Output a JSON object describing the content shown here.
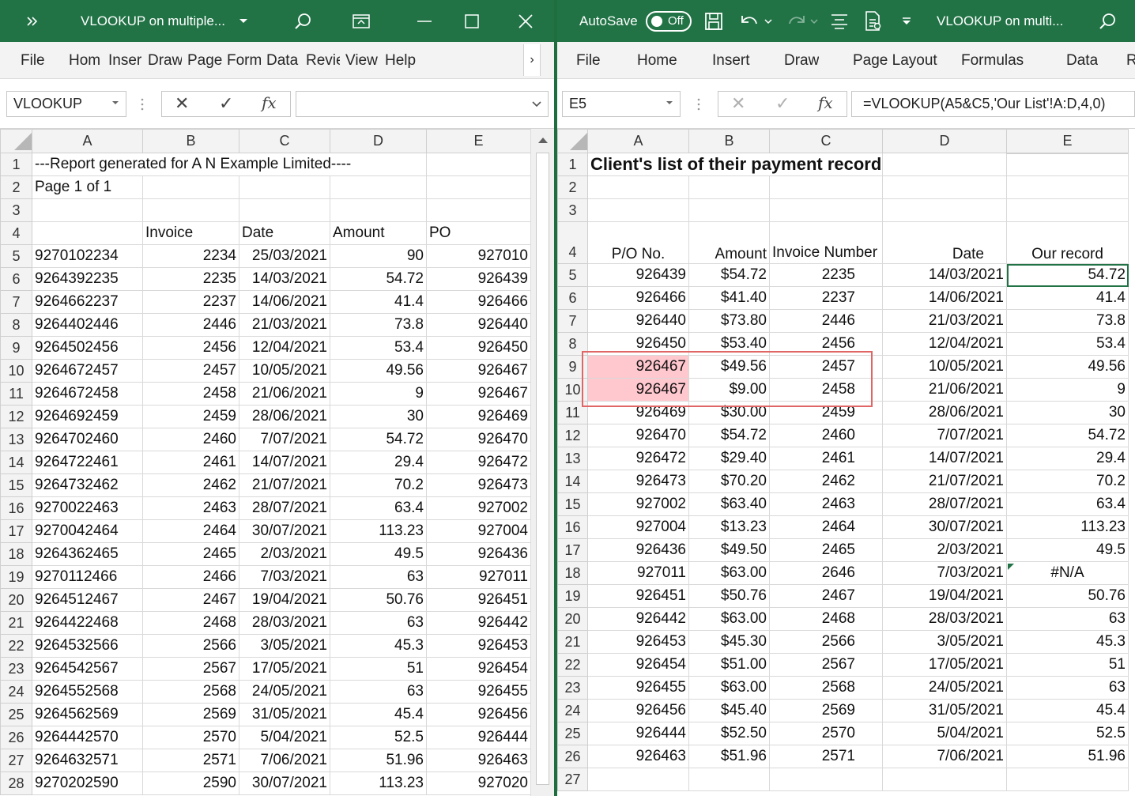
{
  "left": {
    "title": "VLOOKUP on multiple...",
    "ribbon_tabs": [
      "File",
      "Hom",
      "Inser",
      "Draw",
      "Page",
      "Form",
      "Data",
      "Revie",
      "View",
      "Help"
    ],
    "ribbon_more": "›",
    "name_box": "VLOOKUP",
    "formula": "",
    "columns": [
      "A",
      "B",
      "C",
      "D",
      "E"
    ],
    "rows": [
      {
        "n": "1",
        "a": "---Report generated for A N Example Limited----",
        "b": "",
        "c": "",
        "d": "",
        "e": ""
      },
      {
        "n": "2",
        "a": "Page 1 of 1",
        "b": "",
        "c": "",
        "d": "",
        "e": ""
      },
      {
        "n": "3",
        "a": "",
        "b": "",
        "c": "",
        "d": "",
        "e": ""
      },
      {
        "n": "4",
        "a": "",
        "b": "Invoice",
        "c": "Date",
        "d": "Amount",
        "e": "PO"
      },
      {
        "n": "5",
        "a": "9270102234",
        "b": "2234",
        "c": "25/03/2021",
        "d": "90",
        "e": "927010"
      },
      {
        "n": "6",
        "a": "9264392235",
        "b": "2235",
        "c": "14/03/2021",
        "d": "54.72",
        "e": "926439"
      },
      {
        "n": "7",
        "a": "9264662237",
        "b": "2237",
        "c": "14/06/2021",
        "d": "41.4",
        "e": "926466"
      },
      {
        "n": "8",
        "a": "9264402446",
        "b": "2446",
        "c": "21/03/2021",
        "d": "73.8",
        "e": "926440"
      },
      {
        "n": "9",
        "a": "9264502456",
        "b": "2456",
        "c": "12/04/2021",
        "d": "53.4",
        "e": "926450"
      },
      {
        "n": "10",
        "a": "9264672457",
        "b": "2457",
        "c": "10/05/2021",
        "d": "49.56",
        "e": "926467"
      },
      {
        "n": "11",
        "a": "9264672458",
        "b": "2458",
        "c": "21/06/2021",
        "d": "9",
        "e": "926467"
      },
      {
        "n": "12",
        "a": "9264692459",
        "b": "2459",
        "c": "28/06/2021",
        "d": "30",
        "e": "926469"
      },
      {
        "n": "13",
        "a": "9264702460",
        "b": "2460",
        "c": "7/07/2021",
        "d": "54.72",
        "e": "926470"
      },
      {
        "n": "14",
        "a": "9264722461",
        "b": "2461",
        "c": "14/07/2021",
        "d": "29.4",
        "e": "926472"
      },
      {
        "n": "15",
        "a": "9264732462",
        "b": "2462",
        "c": "21/07/2021",
        "d": "70.2",
        "e": "926473"
      },
      {
        "n": "16",
        "a": "9270022463",
        "b": "2463",
        "c": "28/07/2021",
        "d": "63.4",
        "e": "927002"
      },
      {
        "n": "17",
        "a": "9270042464",
        "b": "2464",
        "c": "30/07/2021",
        "d": "113.23",
        "e": "927004"
      },
      {
        "n": "18",
        "a": "9264362465",
        "b": "2465",
        "c": "2/03/2021",
        "d": "49.5",
        "e": "926436"
      },
      {
        "n": "19",
        "a": "9270112466",
        "b": "2466",
        "c": "7/03/2021",
        "d": "63",
        "e": "927011"
      },
      {
        "n": "20",
        "a": "9264512467",
        "b": "2467",
        "c": "19/04/2021",
        "d": "50.76",
        "e": "926451"
      },
      {
        "n": "21",
        "a": "9264422468",
        "b": "2468",
        "c": "28/03/2021",
        "d": "63",
        "e": "926442"
      },
      {
        "n": "22",
        "a": "9264532566",
        "b": "2566",
        "c": "3/05/2021",
        "d": "45.3",
        "e": "926453"
      },
      {
        "n": "23",
        "a": "9264542567",
        "b": "2567",
        "c": "17/05/2021",
        "d": "51",
        "e": "926454"
      },
      {
        "n": "24",
        "a": "9264552568",
        "b": "2568",
        "c": "24/05/2021",
        "d": "63",
        "e": "926455"
      },
      {
        "n": "25",
        "a": "9264562569",
        "b": "2569",
        "c": "31/05/2021",
        "d": "45.4",
        "e": "926456"
      },
      {
        "n": "26",
        "a": "9264442570",
        "b": "2570",
        "c": "5/04/2021",
        "d": "52.5",
        "e": "926444"
      },
      {
        "n": "27",
        "a": "9264632571",
        "b": "2571",
        "c": "7/06/2021",
        "d": "51.96",
        "e": "926463"
      },
      {
        "n": "28",
        "a": "9270202590",
        "b": "2590",
        "c": "30/07/2021",
        "d": "113.23",
        "e": "927020"
      }
    ]
  },
  "right": {
    "autosave_label": "AutoSave",
    "autosave_state": "Off",
    "title": "VLOOKUP on multi...",
    "ribbon_tabs": [
      "File",
      "Home",
      "Insert",
      "Draw",
      "Page Layout",
      "Formulas",
      "Data",
      "R"
    ],
    "name_box": "E5",
    "formula": "=VLOOKUP(A5&C5,'Our List'!A:D,4,0)",
    "columns": [
      "A",
      "B",
      "C",
      "D",
      "E"
    ],
    "title_cell": "Client's list of their payment records",
    "header_row": {
      "n": "4",
      "a": "P/O No.",
      "b": "Amount",
      "c": "Invoice Number",
      "d": "Date",
      "e": "Our record"
    },
    "rows": [
      {
        "n": "5",
        "a": "926439",
        "b": "$54.72",
        "c": "2235",
        "d": "14/03/2021",
        "e": "54.72"
      },
      {
        "n": "6",
        "a": "926466",
        "b": "$41.40",
        "c": "2237",
        "d": "14/06/2021",
        "e": "41.4"
      },
      {
        "n": "7",
        "a": "926440",
        "b": "$73.80",
        "c": "2446",
        "d": "21/03/2021",
        "e": "73.8"
      },
      {
        "n": "8",
        "a": "926450",
        "b": "$53.40",
        "c": "2456",
        "d": "12/04/2021",
        "e": "53.4"
      },
      {
        "n": "9",
        "a": "926467",
        "b": "$49.56",
        "c": "2457",
        "d": "10/05/2021",
        "e": "49.56"
      },
      {
        "n": "10",
        "a": "926467",
        "b": "$9.00",
        "c": "2458",
        "d": "21/06/2021",
        "e": "9"
      },
      {
        "n": "11",
        "a": "926469",
        "b": "$30.00",
        "c": "2459",
        "d": "28/06/2021",
        "e": "30"
      },
      {
        "n": "12",
        "a": "926470",
        "b": "$54.72",
        "c": "2460",
        "d": "7/07/2021",
        "e": "54.72"
      },
      {
        "n": "13",
        "a": "926472",
        "b": "$29.40",
        "c": "2461",
        "d": "14/07/2021",
        "e": "29.4"
      },
      {
        "n": "14",
        "a": "926473",
        "b": "$70.20",
        "c": "2462",
        "d": "21/07/2021",
        "e": "70.2"
      },
      {
        "n": "15",
        "a": "927002",
        "b": "$63.40",
        "c": "2463",
        "d": "28/07/2021",
        "e": "63.4"
      },
      {
        "n": "16",
        "a": "927004",
        "b": "$13.23",
        "c": "2464",
        "d": "30/07/2021",
        "e": "113.23"
      },
      {
        "n": "17",
        "a": "926436",
        "b": "$49.50",
        "c": "2465",
        "d": "2/03/2021",
        "e": "49.5"
      },
      {
        "n": "18",
        "a": "927011",
        "b": "$63.00",
        "c": "2646",
        "d": "7/03/2021",
        "e": "#N/A"
      },
      {
        "n": "19",
        "a": "926451",
        "b": "$50.76",
        "c": "2467",
        "d": "19/04/2021",
        "e": "50.76"
      },
      {
        "n": "20",
        "a": "926442",
        "b": "$63.00",
        "c": "2468",
        "d": "28/03/2021",
        "e": "63"
      },
      {
        "n": "21",
        "a": "926453",
        "b": "$45.30",
        "c": "2566",
        "d": "3/05/2021",
        "e": "45.3"
      },
      {
        "n": "22",
        "a": "926454",
        "b": "$51.00",
        "c": "2567",
        "d": "17/05/2021",
        "e": "51"
      },
      {
        "n": "23",
        "a": "926455",
        "b": "$63.00",
        "c": "2568",
        "d": "24/05/2021",
        "e": "63"
      },
      {
        "n": "24",
        "a": "926456",
        "b": "$45.40",
        "c": "2569",
        "d": "31/05/2021",
        "e": "45.4"
      },
      {
        "n": "25",
        "a": "926444",
        "b": "$52.50",
        "c": "2570",
        "d": "5/04/2021",
        "e": "52.5"
      },
      {
        "n": "26",
        "a": "926463",
        "b": "$51.96",
        "c": "2571",
        "d": "7/06/2021",
        "e": "51.96"
      },
      {
        "n": "27",
        "a": "",
        "b": "",
        "c": "",
        "d": "",
        "e": ""
      }
    ]
  },
  "icons": {
    "fx": "fx",
    "cancel": "✕",
    "enter": "✓"
  },
  "colors": {
    "excel_green": "#217346",
    "duplicate_fill": "#ffc7ce",
    "duplicate_text": "#9c0006",
    "highlight_box": "#e06666"
  }
}
